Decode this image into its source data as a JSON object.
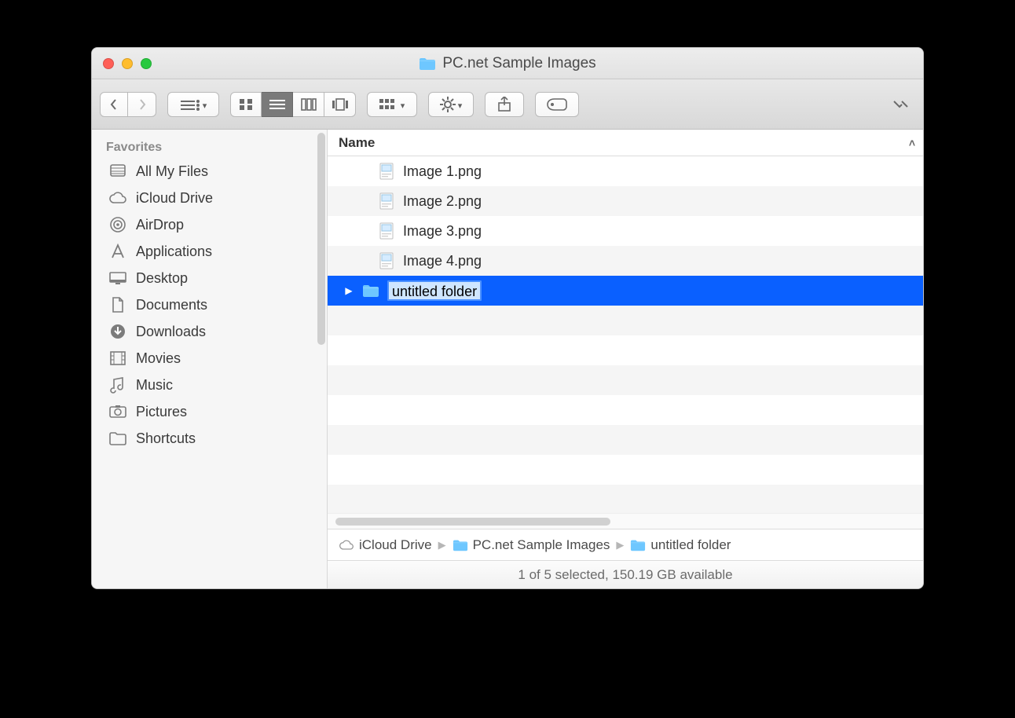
{
  "window": {
    "title": "PC.net Sample Images"
  },
  "sidebar": {
    "header": "Favorites",
    "items": [
      {
        "icon": "all-my-files",
        "label": "All My Files"
      },
      {
        "icon": "icloud",
        "label": "iCloud Drive"
      },
      {
        "icon": "airdrop",
        "label": "AirDrop"
      },
      {
        "icon": "applications",
        "label": "Applications"
      },
      {
        "icon": "desktop",
        "label": "Desktop"
      },
      {
        "icon": "documents",
        "label": "Documents"
      },
      {
        "icon": "downloads",
        "label": "Downloads"
      },
      {
        "icon": "movies",
        "label": "Movies"
      },
      {
        "icon": "music",
        "label": "Music"
      },
      {
        "icon": "pictures",
        "label": "Pictures"
      },
      {
        "icon": "folder",
        "label": "Shortcuts"
      }
    ]
  },
  "columns": {
    "name": "Name"
  },
  "files": [
    {
      "type": "png",
      "name": "Image 1.png",
      "selected": false,
      "folder": false
    },
    {
      "type": "png",
      "name": "Image 2.png",
      "selected": false,
      "folder": false
    },
    {
      "type": "png",
      "name": "Image 3.png",
      "selected": false,
      "folder": false
    },
    {
      "type": "png",
      "name": "Image 4.png",
      "selected": false,
      "folder": false
    },
    {
      "type": "folder",
      "name": "untitled folder",
      "selected": true,
      "folder": true,
      "editing": true
    }
  ],
  "path": [
    {
      "icon": "icloud",
      "label": "iCloud Drive"
    },
    {
      "icon": "folder",
      "label": "PC.net Sample Images"
    },
    {
      "icon": "folder",
      "label": "untitled folder"
    }
  ],
  "status": "1 of 5 selected, 150.19 GB available"
}
